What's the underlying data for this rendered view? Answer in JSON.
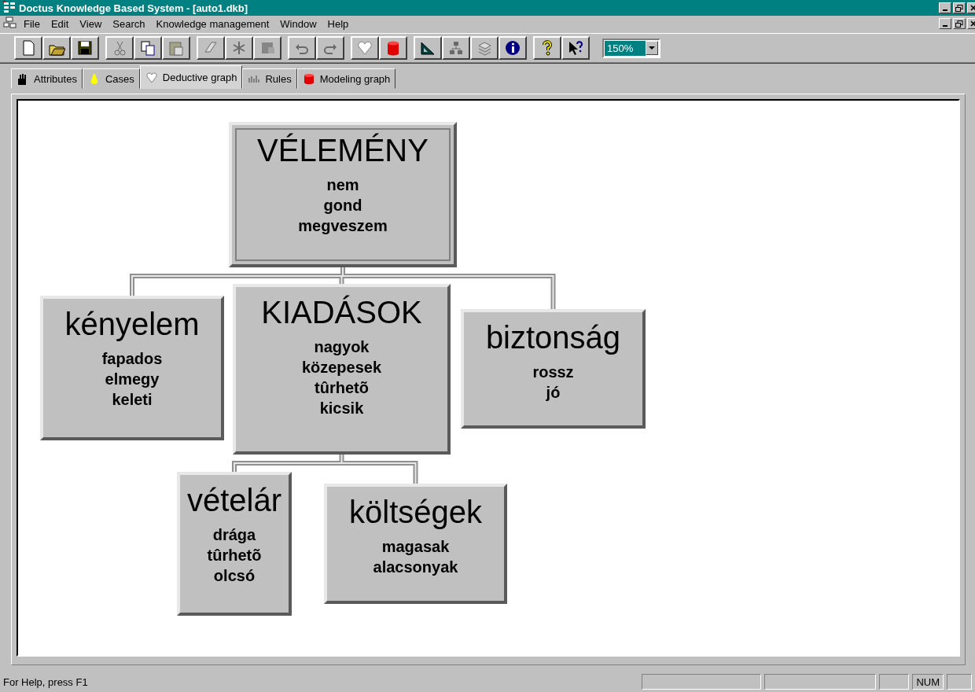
{
  "window": {
    "title": "Doctus Knowledge Based System - [auto1.dkb]"
  },
  "menu": [
    "File",
    "Edit",
    "View",
    "Search",
    "Knowledge management",
    "Window",
    "Help"
  ],
  "toolbar": [
    [
      {
        "disabled": false
      },
      {
        "disabled": false
      },
      {
        "disabled": false
      }
    ],
    [
      {
        "disabled": true
      },
      {
        "disabled": false
      },
      {
        "disabled": true
      }
    ],
    [
      {
        "disabled": true
      },
      {
        "disabled": true
      },
      {
        "disabled": true
      }
    ],
    [
      {
        "disabled": true
      },
      {
        "disabled": true
      }
    ],
    [
      {
        "disabled": false
      },
      {
        "disabled": false
      }
    ],
    [
      {
        "disabled": false
      },
      {
        "disabled": true
      },
      {
        "disabled": true
      },
      {
        "disabled": false
      }
    ],
    [
      {
        "disabled": false
      },
      {
        "disabled": false
      }
    ]
  ],
  "zoom": {
    "value": "150%"
  },
  "tabs": [
    {
      "label": "Attributes",
      "selected": false
    },
    {
      "label": "Cases",
      "selected": false
    },
    {
      "label": "Deductive graph",
      "selected": true
    },
    {
      "label": "Rules",
      "selected": false
    },
    {
      "label": "Modeling graph",
      "selected": false
    }
  ],
  "graph": {
    "name": "VÉLEMÉNY",
    "values": [
      "nem",
      "gond",
      "megveszem"
    ],
    "children": [
      {
        "name": "kényelem",
        "values": [
          "fapados",
          "elmegy",
          "keleti"
        ]
      },
      {
        "name": "KIADÁSOK",
        "values": [
          "nagyok",
          "közepesek",
          "tûrhetõ",
          "kicsik"
        ],
        "children": [
          {
            "name": "vételár",
            "values": [
              "drága",
              "tûrhetõ",
              "olcsó"
            ]
          },
          {
            "name": "költségek",
            "values": [
              "magasak",
              "alacsonyak"
            ]
          }
        ]
      },
      {
        "name": "biztonság",
        "values": [
          "rossz",
          "jó"
        ]
      }
    ]
  },
  "status_bar": {
    "text": "For Help, press F1",
    "indicators": [
      "NUM"
    ]
  }
}
